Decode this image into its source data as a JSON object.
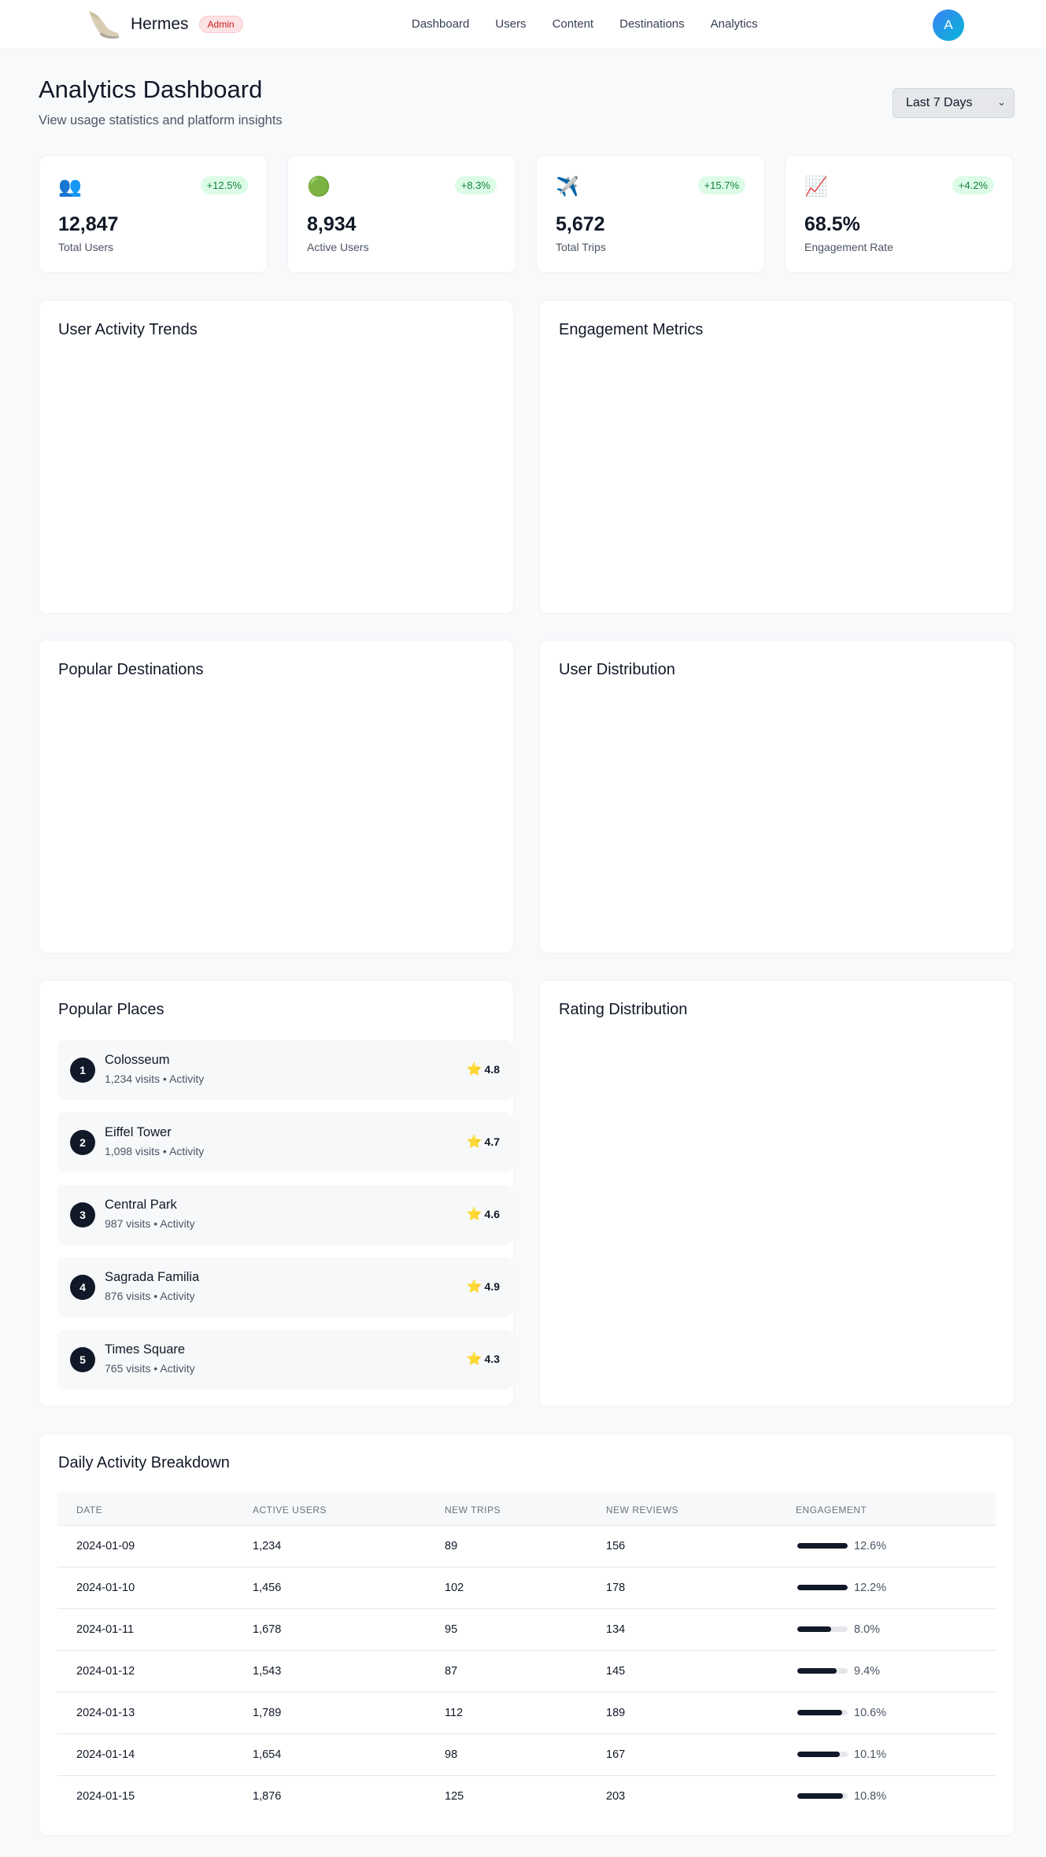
{
  "nav": {
    "brand": "Hermes",
    "badge": "Admin",
    "links": [
      "Dashboard",
      "Users",
      "Content",
      "Destinations",
      "Analytics"
    ],
    "avatar_initial": "A"
  },
  "header": {
    "title": "Analytics Dashboard",
    "subtitle": "View usage statistics and platform insights",
    "period": "Last 7 Days"
  },
  "stats": [
    {
      "icon": "👥",
      "icon_name": "users-icon",
      "change": "+12.5%",
      "value": "12,847",
      "label": "Total Users"
    },
    {
      "icon": "🟢",
      "icon_name": "active-dot-icon",
      "change": "+8.3%",
      "value": "8,934",
      "label": "Active Users"
    },
    {
      "icon": "✈️",
      "icon_name": "airplane-icon",
      "change": "+15.7%",
      "value": "5,672",
      "label": "Total Trips"
    },
    {
      "icon": "📈",
      "icon_name": "trending-up-icon",
      "change": "+4.2%",
      "value": "68.5%",
      "label": "Engagement Rate"
    }
  ],
  "panels": {
    "activity_trends": "User Activity Trends",
    "engagement_metrics": "Engagement Metrics",
    "popular_destinations": "Popular Destinations",
    "user_distribution": "User Distribution",
    "popular_places": "Popular Places",
    "rating_distribution": "Rating Distribution",
    "daily_breakdown": "Daily Activity Breakdown"
  },
  "places": [
    {
      "rank": "1",
      "name": "Colosseum",
      "meta": "1,234 visits • Activity",
      "rating": "4.8"
    },
    {
      "rank": "2",
      "name": "Eiffel Tower",
      "meta": "1,098 visits • Activity",
      "rating": "4.7"
    },
    {
      "rank": "3",
      "name": "Central Park",
      "meta": "987 visits • Activity",
      "rating": "4.6"
    },
    {
      "rank": "4",
      "name": "Sagrada Familia",
      "meta": "876 visits • Activity",
      "rating": "4.9"
    },
    {
      "rank": "5",
      "name": "Times Square",
      "meta": "765 visits • Activity",
      "rating": "4.3"
    }
  ],
  "rating_star": "⭐",
  "table": {
    "headers": [
      "DATE",
      "ACTIVE USERS",
      "NEW TRIPS",
      "NEW REVIEWS",
      "ENGAGEMENT"
    ],
    "rows": [
      {
        "date": "2024-01-09",
        "active": "1,234",
        "trips": "89",
        "reviews": "156",
        "engagement": "12.6%",
        "engagement_value": 12.6
      },
      {
        "date": "2024-01-10",
        "active": "1,456",
        "trips": "102",
        "reviews": "178",
        "engagement": "12.2%",
        "engagement_value": 12.2
      },
      {
        "date": "2024-01-11",
        "active": "1,678",
        "trips": "95",
        "reviews": "134",
        "engagement": "8.0%",
        "engagement_value": 8.0
      },
      {
        "date": "2024-01-12",
        "active": "1,543",
        "trips": "87",
        "reviews": "145",
        "engagement": "9.4%",
        "engagement_value": 9.4
      },
      {
        "date": "2024-01-13",
        "active": "1,789",
        "trips": "112",
        "reviews": "189",
        "engagement": "10.6%",
        "engagement_value": 10.6
      },
      {
        "date": "2024-01-14",
        "active": "1,654",
        "trips": "98",
        "reviews": "167",
        "engagement": "10.1%",
        "engagement_value": 10.1
      },
      {
        "date": "2024-01-15",
        "active": "1,876",
        "trips": "125",
        "reviews": "203",
        "engagement": "10.8%",
        "engagement_value": 10.8
      }
    ]
  }
}
